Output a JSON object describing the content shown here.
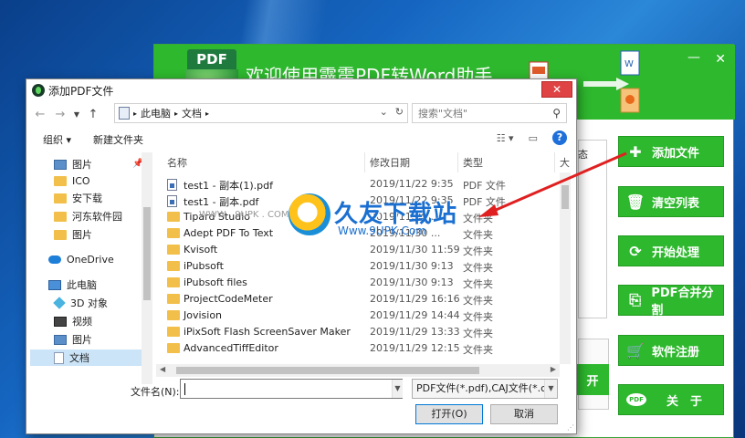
{
  "app": {
    "title": "欢迎使用霹雳PDF转Word助手",
    "logo_text": "PDF",
    "minimize": "—",
    "close": "✕",
    "buttons": [
      {
        "label": "添加文件",
        "icon": "add-file-icon"
      },
      {
        "label": "清空列表",
        "icon": "trash-icon"
      },
      {
        "label": "开始处理",
        "icon": "refresh-icon"
      },
      {
        "label": "PDF合并分割",
        "icon": "merge-icon"
      },
      {
        "label": "软件注册",
        "icon": "cart-icon"
      },
      {
        "label": "关　于",
        "icon": "pdf-badge-icon"
      }
    ],
    "grid_header": "态",
    "open_btn": "开"
  },
  "dialog": {
    "title": "添加PDF文件",
    "close": "✕",
    "address": {
      "segments": [
        "此电脑",
        "文档"
      ]
    },
    "search_placeholder": "搜索\"文档\"",
    "toolbar": {
      "organize": "组织 ▾",
      "new_folder": "新建文件夹"
    },
    "tree": [
      {
        "label": "图片",
        "icon": "pictures-icon",
        "pinned": true
      },
      {
        "label": "ICO",
        "icon": "folder-icon"
      },
      {
        "label": "安下载",
        "icon": "folder-icon"
      },
      {
        "label": "河东软件园",
        "icon": "folder-icon"
      },
      {
        "label": "图片",
        "icon": "folder-icon"
      },
      {
        "label": "OneDrive",
        "icon": "onedrive-icon"
      },
      {
        "label": "此电脑",
        "icon": "computer-icon"
      },
      {
        "label": "3D 对象",
        "icon": "3d-objects-icon"
      },
      {
        "label": "视频",
        "icon": "video-icon"
      },
      {
        "label": "图片",
        "icon": "pictures-icon"
      },
      {
        "label": "文档",
        "icon": "documents-icon",
        "selected": true
      }
    ],
    "columns": {
      "name": "名称",
      "date": "修改日期",
      "type": "类型",
      "size": "大"
    },
    "files": [
      {
        "name": "test1 - 副本(1).pdf",
        "date": "2019/11/22 9:35",
        "type": "PDF 文件",
        "kind": "pdf"
      },
      {
        "name": "test1 - 副本.pdf",
        "date": "2019/11/22 9:35",
        "type": "PDF 文件",
        "kind": "pdf"
      },
      {
        "name": "Tipard Studio",
        "date": "2019/11/30 ...",
        "type": "文件夹",
        "kind": "folder"
      },
      {
        "name": "Adept PDF To Text",
        "date": "2019/11/30 ...",
        "type": "文件夹",
        "kind": "folder"
      },
      {
        "name": "Kvisoft",
        "date": "2019/11/30 11:59",
        "type": "文件夹",
        "kind": "folder"
      },
      {
        "name": "iPubsoft",
        "date": "2019/11/30 9:13",
        "type": "文件夹",
        "kind": "folder"
      },
      {
        "name": "iPubsoft files",
        "date": "2019/11/30 9:13",
        "type": "文件夹",
        "kind": "folder"
      },
      {
        "name": "ProjectCodeMeter",
        "date": "2019/11/29 16:16",
        "type": "文件夹",
        "kind": "folder"
      },
      {
        "name": "Jovision",
        "date": "2019/11/29 14:44",
        "type": "文件夹",
        "kind": "folder"
      },
      {
        "name": "iPixSoft Flash ScreenSaver Maker",
        "date": "2019/11/29 13:33",
        "type": "文件夹",
        "kind": "folder"
      },
      {
        "name": "AdvancedTiffEditor",
        "date": "2019/11/29 12:15",
        "type": "文件夹",
        "kind": "folder"
      }
    ],
    "filename_label": "文件名(N):",
    "filename_value": "",
    "filter": "PDF文件(*.pdf),CAJ文件(*.caj)",
    "open_button": "打开(O)",
    "cancel_button": "取消"
  },
  "watermark": {
    "brand": "久友下载站",
    "url": "Www.9UPK.Com",
    "mid_text": "WWW . 9UPK . COM"
  },
  "colors": {
    "app_green": "#2eb82e",
    "close_red": "#e04343",
    "selection_blue": "#cce4f7",
    "arrow_red": "#e02020"
  }
}
